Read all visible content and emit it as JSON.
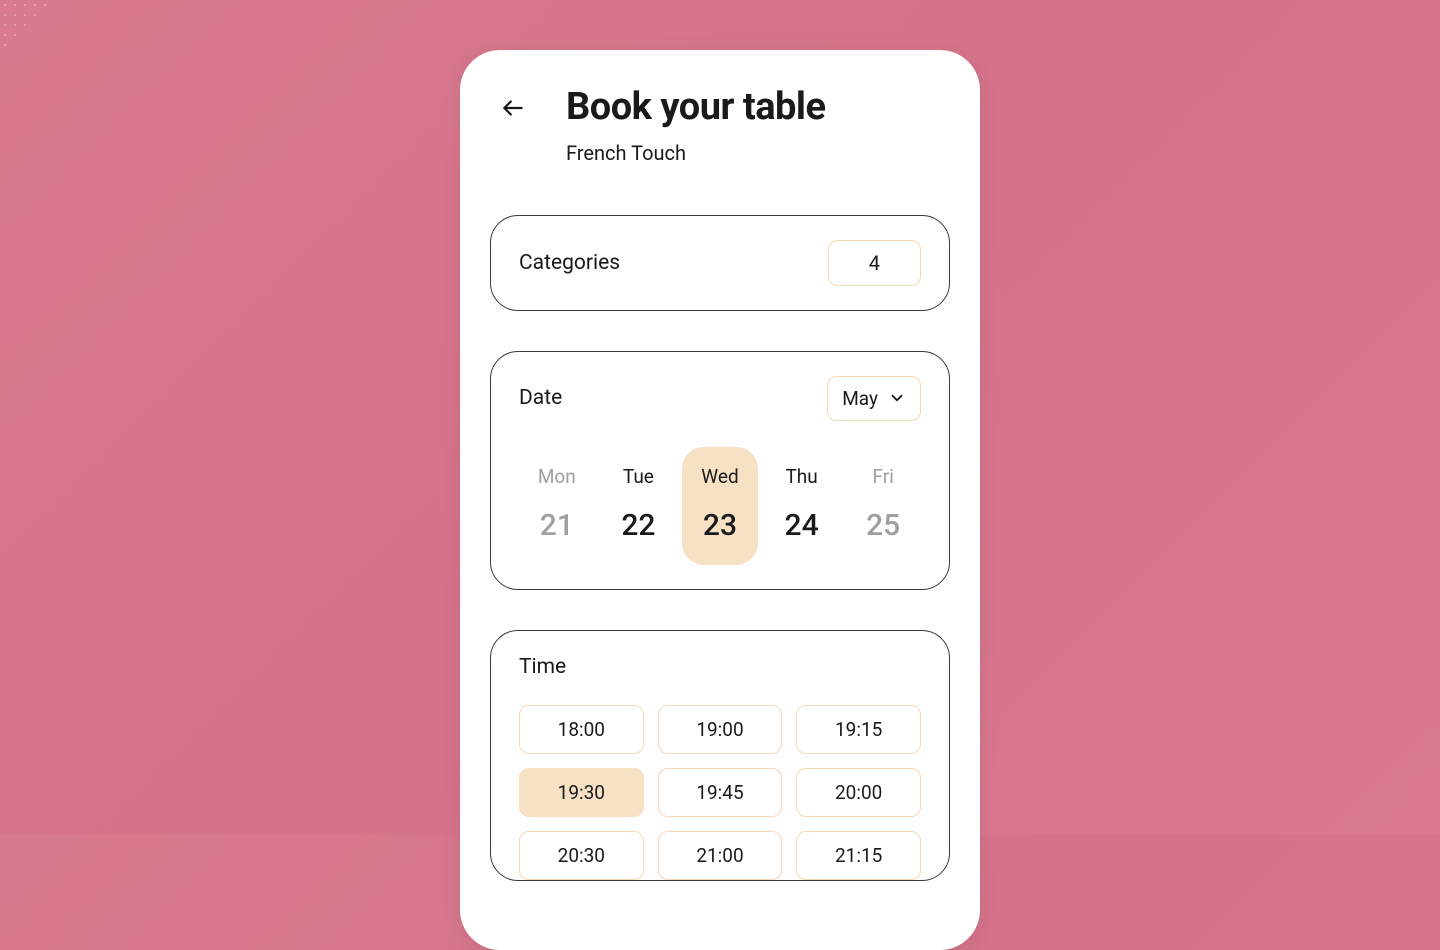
{
  "header": {
    "title": "Book your table",
    "subtitle": "French Touch"
  },
  "categories": {
    "label": "Categories",
    "value": "4"
  },
  "date": {
    "label": "Date",
    "month": "May",
    "days": [
      {
        "name": "Mon",
        "num": "21",
        "dim": true,
        "selected": false
      },
      {
        "name": "Tue",
        "num": "22",
        "dim": false,
        "selected": false
      },
      {
        "name": "Wed",
        "num": "23",
        "dim": false,
        "selected": true
      },
      {
        "name": "Thu",
        "num": "24",
        "dim": false,
        "selected": false
      },
      {
        "name": "Fri",
        "num": "25",
        "dim": true,
        "selected": false
      }
    ]
  },
  "time": {
    "label": "Time",
    "slots": [
      {
        "t": "18:00",
        "selected": false
      },
      {
        "t": "19:00",
        "selected": false
      },
      {
        "t": "19:15",
        "selected": false
      },
      {
        "t": "19:30",
        "selected": true
      },
      {
        "t": "19:45",
        "selected": false
      },
      {
        "t": "20:00",
        "selected": false
      },
      {
        "t": "20:30",
        "selected": false
      },
      {
        "t": "21:00",
        "selected": false
      },
      {
        "t": "21:15",
        "selected": false
      }
    ]
  },
  "colors": {
    "background_pink": "#d87a8f",
    "accent_peach": "#f7e1c4",
    "border_peach": "#f5d9b3",
    "text": "#1a1a1a",
    "dim": "#9f9f9f"
  }
}
